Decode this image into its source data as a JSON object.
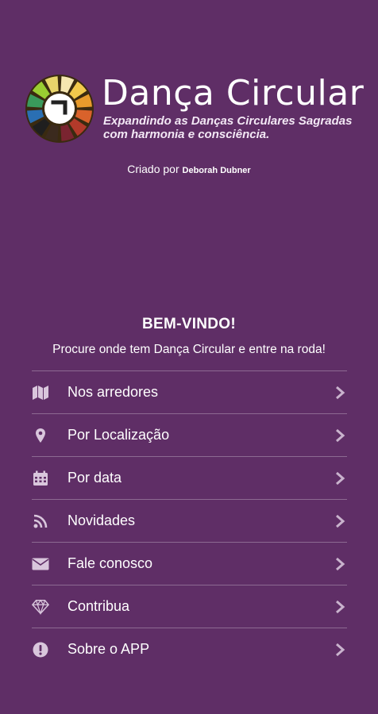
{
  "brand": {
    "title": "Dança Circular",
    "tagline_line1": "Expandindo as Danças Circulares Sagradas",
    "tagline_line2": "com harmonia e consciência."
  },
  "credit": {
    "prefix": "Criado por",
    "author": "Deborah Dubner"
  },
  "welcome": {
    "title": "BEM-VINDO!",
    "subtitle": "Procure onde tem Dança Circular e entre na roda!"
  },
  "menu": {
    "items": [
      {
        "label": "Nos arredores",
        "icon": "map-icon"
      },
      {
        "label": "Por Localização",
        "icon": "location-pin-icon"
      },
      {
        "label": "Por data",
        "icon": "calendar-icon"
      },
      {
        "label": "Novidades",
        "icon": "rss-icon"
      },
      {
        "label": "Fale conosco",
        "icon": "envelope-icon"
      },
      {
        "label": "Contribua",
        "icon": "diamond-icon"
      },
      {
        "label": "Sobre o APP",
        "icon": "info-icon"
      }
    ]
  },
  "colors": {
    "background": "#5f2e66",
    "divider": "#8d6a92",
    "icon": "#d9c6dc",
    "chevron": "#c9b3cd"
  }
}
